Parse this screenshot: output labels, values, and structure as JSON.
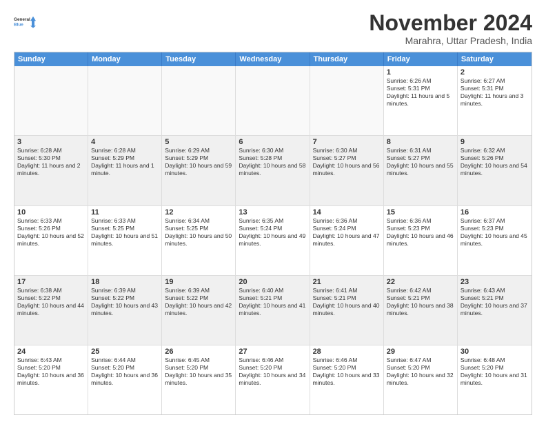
{
  "logo": {
    "line1": "General",
    "line2": "Blue"
  },
  "title": "November 2024",
  "location": "Marahra, Uttar Pradesh, India",
  "days": [
    "Sunday",
    "Monday",
    "Tuesday",
    "Wednesday",
    "Thursday",
    "Friday",
    "Saturday"
  ],
  "weeks": [
    [
      {
        "day": "",
        "empty": true
      },
      {
        "day": "",
        "empty": true
      },
      {
        "day": "",
        "empty": true
      },
      {
        "day": "",
        "empty": true
      },
      {
        "day": "",
        "empty": true
      },
      {
        "day": "1",
        "rise": "6:26 AM",
        "set": "5:31 PM",
        "hours": "11 hours and 5 minutes."
      },
      {
        "day": "2",
        "rise": "6:27 AM",
        "set": "5:31 PM",
        "hours": "11 hours and 3 minutes."
      }
    ],
    [
      {
        "day": "3",
        "rise": "6:28 AM",
        "set": "5:30 PM",
        "hours": "11 hours and 2 minutes."
      },
      {
        "day": "4",
        "rise": "6:28 AM",
        "set": "5:29 PM",
        "hours": "11 hours and 1 minute."
      },
      {
        "day": "5",
        "rise": "6:29 AM",
        "set": "5:29 PM",
        "hours": "10 hours and 59 minutes."
      },
      {
        "day": "6",
        "rise": "6:30 AM",
        "set": "5:28 PM",
        "hours": "10 hours and 58 minutes."
      },
      {
        "day": "7",
        "rise": "6:30 AM",
        "set": "5:27 PM",
        "hours": "10 hours and 56 minutes."
      },
      {
        "day": "8",
        "rise": "6:31 AM",
        "set": "5:27 PM",
        "hours": "10 hours and 55 minutes."
      },
      {
        "day": "9",
        "rise": "6:32 AM",
        "set": "5:26 PM",
        "hours": "10 hours and 54 minutes."
      }
    ],
    [
      {
        "day": "10",
        "rise": "6:33 AM",
        "set": "5:26 PM",
        "hours": "10 hours and 52 minutes."
      },
      {
        "day": "11",
        "rise": "6:33 AM",
        "set": "5:25 PM",
        "hours": "10 hours and 51 minutes."
      },
      {
        "day": "12",
        "rise": "6:34 AM",
        "set": "5:25 PM",
        "hours": "10 hours and 50 minutes."
      },
      {
        "day": "13",
        "rise": "6:35 AM",
        "set": "5:24 PM",
        "hours": "10 hours and 49 minutes."
      },
      {
        "day": "14",
        "rise": "6:36 AM",
        "set": "5:24 PM",
        "hours": "10 hours and 47 minutes."
      },
      {
        "day": "15",
        "rise": "6:36 AM",
        "set": "5:23 PM",
        "hours": "10 hours and 46 minutes."
      },
      {
        "day": "16",
        "rise": "6:37 AM",
        "set": "5:23 PM",
        "hours": "10 hours and 45 minutes."
      }
    ],
    [
      {
        "day": "17",
        "rise": "6:38 AM",
        "set": "5:22 PM",
        "hours": "10 hours and 44 minutes."
      },
      {
        "day": "18",
        "rise": "6:39 AM",
        "set": "5:22 PM",
        "hours": "10 hours and 43 minutes."
      },
      {
        "day": "19",
        "rise": "6:39 AM",
        "set": "5:22 PM",
        "hours": "10 hours and 42 minutes."
      },
      {
        "day": "20",
        "rise": "6:40 AM",
        "set": "5:21 PM",
        "hours": "10 hours and 41 minutes."
      },
      {
        "day": "21",
        "rise": "6:41 AM",
        "set": "5:21 PM",
        "hours": "10 hours and 40 minutes."
      },
      {
        "day": "22",
        "rise": "6:42 AM",
        "set": "5:21 PM",
        "hours": "10 hours and 38 minutes."
      },
      {
        "day": "23",
        "rise": "6:43 AM",
        "set": "5:21 PM",
        "hours": "10 hours and 37 minutes."
      }
    ],
    [
      {
        "day": "24",
        "rise": "6:43 AM",
        "set": "5:20 PM",
        "hours": "10 hours and 36 minutes."
      },
      {
        "day": "25",
        "rise": "6:44 AM",
        "set": "5:20 PM",
        "hours": "10 hours and 36 minutes."
      },
      {
        "day": "26",
        "rise": "6:45 AM",
        "set": "5:20 PM",
        "hours": "10 hours and 35 minutes."
      },
      {
        "day": "27",
        "rise": "6:46 AM",
        "set": "5:20 PM",
        "hours": "10 hours and 34 minutes."
      },
      {
        "day": "28",
        "rise": "6:46 AM",
        "set": "5:20 PM",
        "hours": "10 hours and 33 minutes."
      },
      {
        "day": "29",
        "rise": "6:47 AM",
        "set": "5:20 PM",
        "hours": "10 hours and 32 minutes."
      },
      {
        "day": "30",
        "rise": "6:48 AM",
        "set": "5:20 PM",
        "hours": "10 hours and 31 minutes."
      }
    ]
  ]
}
